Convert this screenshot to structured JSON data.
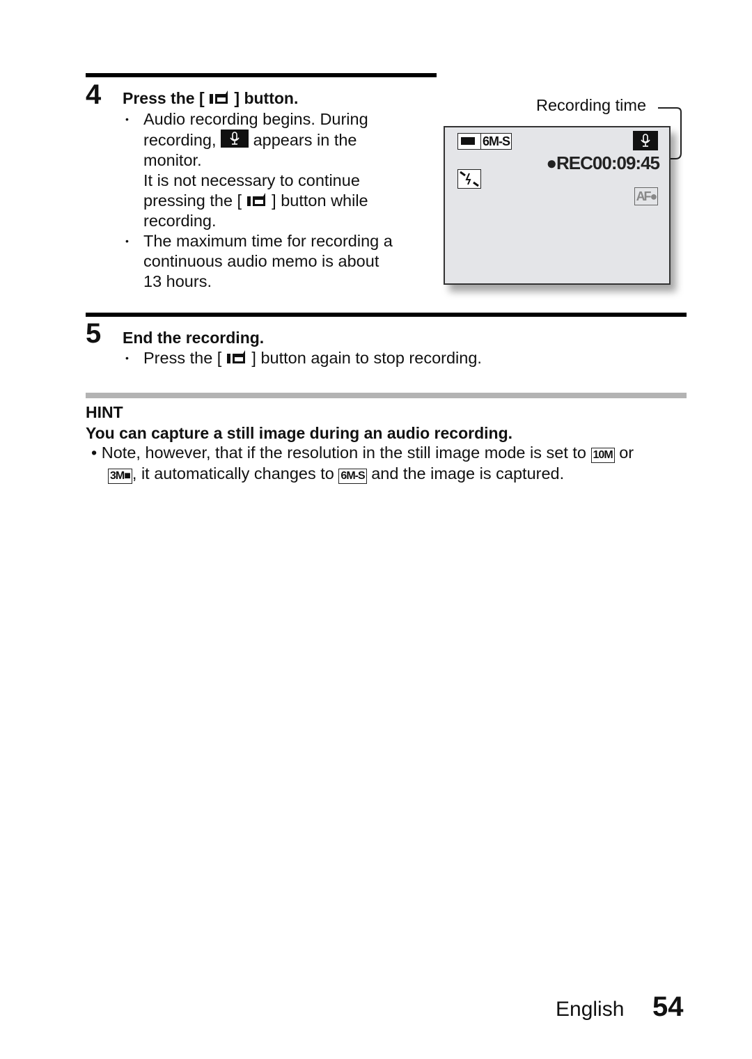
{
  "step4": {
    "number": "4",
    "title_pre": "Press the [",
    "title_post": "] button.",
    "key_icon": "movie-camera-icon",
    "bullets": [
      {
        "lines": [
          "Audio recording begins. During"
        ],
        "line2_pre": "recording,",
        "line2_icon": "microphone-icon",
        "line2_post": "appears in the",
        "line3": "monitor.",
        "line4": "It is not necessary to continue",
        "line5_pre": "pressing the [",
        "line5_post": "] button while",
        "line6": "recording."
      },
      {
        "lines": [
          "The maximum time for recording a",
          "continuous audio memo is about",
          "13 hours."
        ]
      }
    ]
  },
  "monitor": {
    "callout_label": "Recording time",
    "resolution": "6M-S",
    "rec_text": "●REC00:09:45",
    "af_lock": "AF🔒"
  },
  "step5": {
    "number": "5",
    "title": "End the recording.",
    "bullet_pre": "Press the [",
    "bullet_post": "] button again to stop recording."
  },
  "hint": {
    "label": "HINT",
    "title": "You can capture a still image during an audio recording.",
    "line1_pre": "Note, however, that if the resolution in the still image mode is set to",
    "badge1": "10M",
    "line1_post": "or",
    "badge2": "3M■",
    "line2_mid": ", it automatically changes to",
    "badge3": "6M-S",
    "line2_post": "and the image is captured."
  },
  "footer": {
    "language": "English",
    "page": "54"
  },
  "bullet_char": "•"
}
